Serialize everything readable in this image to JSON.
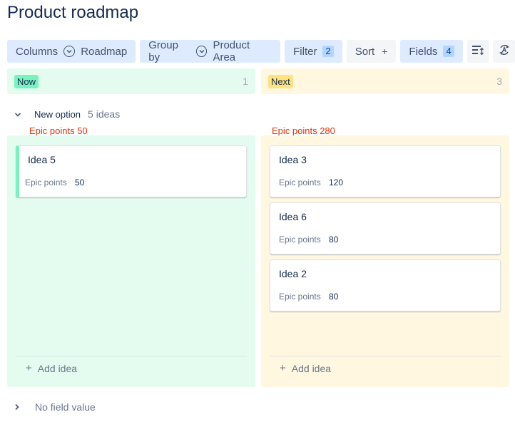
{
  "page": {
    "title": "Product roadmap"
  },
  "toolbar": {
    "columns": {
      "label": "Columns",
      "value": "Roadmap"
    },
    "group_by": {
      "label": "Group by",
      "value": "Product Area"
    },
    "filter": {
      "label": "Filter",
      "count": "2"
    },
    "sort": {
      "label": "Sort",
      "icon": "+"
    },
    "fields": {
      "label": "Fields",
      "count": "4"
    },
    "icons": [
      "view-density-icon",
      "auto-sort-icon"
    ]
  },
  "columns": [
    {
      "label": "Now",
      "count": "1",
      "color": "#79f2c0"
    },
    {
      "label": "Next",
      "count": "3",
      "color": "#ffe380"
    }
  ],
  "groups": [
    {
      "label": "New option",
      "count_text": "5 ideas"
    },
    {
      "label": "No field value"
    }
  ],
  "lanes": [
    {
      "epic_sum": "Epic points 50",
      "cards": [
        {
          "title": "Idea 5",
          "field_label": "Epic points",
          "field_value": "50"
        }
      ],
      "add_label": "Add idea"
    },
    {
      "epic_sum": "Epic points 280",
      "cards": [
        {
          "title": "Idea 3",
          "field_label": "Epic points",
          "field_value": "120"
        },
        {
          "title": "Idea 6",
          "field_label": "Epic points",
          "field_value": "80"
        },
        {
          "title": "Idea 2",
          "field_label": "Epic points",
          "field_value": "80"
        }
      ],
      "add_label": "Add idea"
    }
  ]
}
